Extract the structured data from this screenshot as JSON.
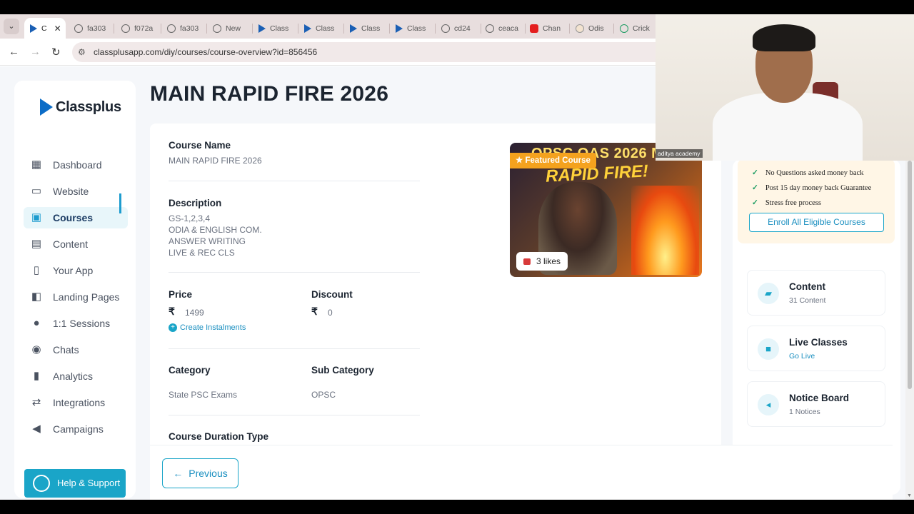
{
  "browser": {
    "tabs": [
      {
        "label": "C",
        "icon": "classplus-icon",
        "active": true
      },
      {
        "label": "fa303",
        "icon": "globe-icon"
      },
      {
        "label": "f072a",
        "icon": "globe-icon"
      },
      {
        "label": "fa303",
        "icon": "globe-icon"
      },
      {
        "label": "New",
        "icon": "globe-icon"
      },
      {
        "label": "Class",
        "icon": "classplus-icon"
      },
      {
        "label": "Class",
        "icon": "classplus-icon"
      },
      {
        "label": "Class",
        "icon": "classplus-icon"
      },
      {
        "label": "Class",
        "icon": "classplus-icon"
      },
      {
        "label": "cd24",
        "icon": "globe-icon"
      },
      {
        "label": "ceaca",
        "icon": "globe-icon"
      },
      {
        "label": "Chan",
        "icon": "youtube-icon"
      },
      {
        "label": "Odis",
        "icon": "odisha-icon"
      },
      {
        "label": "Crick",
        "icon": "cricbuzz-icon"
      }
    ],
    "url": "classplusapp.com/diy/courses/course-overview?id=856456"
  },
  "sidebar": {
    "logo_text": "Classplus",
    "items": [
      {
        "label": "Dashboard",
        "icon": "dashboard-icon"
      },
      {
        "label": "Website",
        "icon": "website-icon"
      },
      {
        "label": "Courses",
        "icon": "courses-icon",
        "active": true
      },
      {
        "label": "Content",
        "icon": "content-icon"
      },
      {
        "label": "Your App",
        "icon": "phone-icon"
      },
      {
        "label": "Landing Pages",
        "icon": "landing-pages-icon"
      },
      {
        "label": "1:1 Sessions",
        "icon": "sessions-icon"
      },
      {
        "label": "Chats",
        "icon": "chats-icon"
      },
      {
        "label": "Analytics",
        "icon": "analytics-icon"
      },
      {
        "label": "Integrations",
        "icon": "integrations-icon"
      },
      {
        "label": "Campaigns",
        "icon": "megaphone-icon"
      }
    ],
    "help_label": "Help & Support"
  },
  "main": {
    "title": "MAIN RAPID FIRE 2026",
    "course_name_label": "Course Name",
    "course_name_value": "MAIN RAPID FIRE 2026",
    "description_label": "Description",
    "description_lines": [
      "GS-1,2,3,4",
      "ODIA & ENGLISH COM.",
      "ANSWER WRITING",
      "LIVE & REC CLS"
    ],
    "price_label": "Price",
    "price_currency": "₹",
    "price_value": "1499",
    "discount_label": "Discount",
    "discount_currency": "₹",
    "discount_value": "0",
    "create_instalments": "Create Instalments",
    "category_label": "Category",
    "category_value": "State PSC Exams",
    "sub_category_label": "Sub Category",
    "sub_category_value": "OPSC",
    "duration_type_label": "Course Duration Type",
    "thumbnail": {
      "banner_top": "OPSC OAS 2026 MAINS",
      "banner_main": "RAPID FIRE!",
      "featured_label": "Featured Course",
      "likes_label": "3 likes"
    },
    "previous_label": "Previous"
  },
  "right_panel": {
    "promo_lines": [
      "No Questions asked money back",
      "Post 15 day money back Guarantee",
      "Stress free process"
    ],
    "enroll_label": "Enroll All Eligible Courses",
    "cards": [
      {
        "title": "Content",
        "sub": "31 Content",
        "icon": "folder-icon"
      },
      {
        "title": "Live Classes",
        "sub": "Go Live",
        "icon": "video-icon"
      },
      {
        "title": "Notice Board",
        "sub": "1 Notices",
        "icon": "speaker-icon"
      }
    ]
  },
  "webcam": {
    "label": "aditya academy"
  },
  "colors": {
    "accent": "#1aa5c8",
    "featured": "#f4a21e",
    "brand": "#0b6cc7"
  }
}
